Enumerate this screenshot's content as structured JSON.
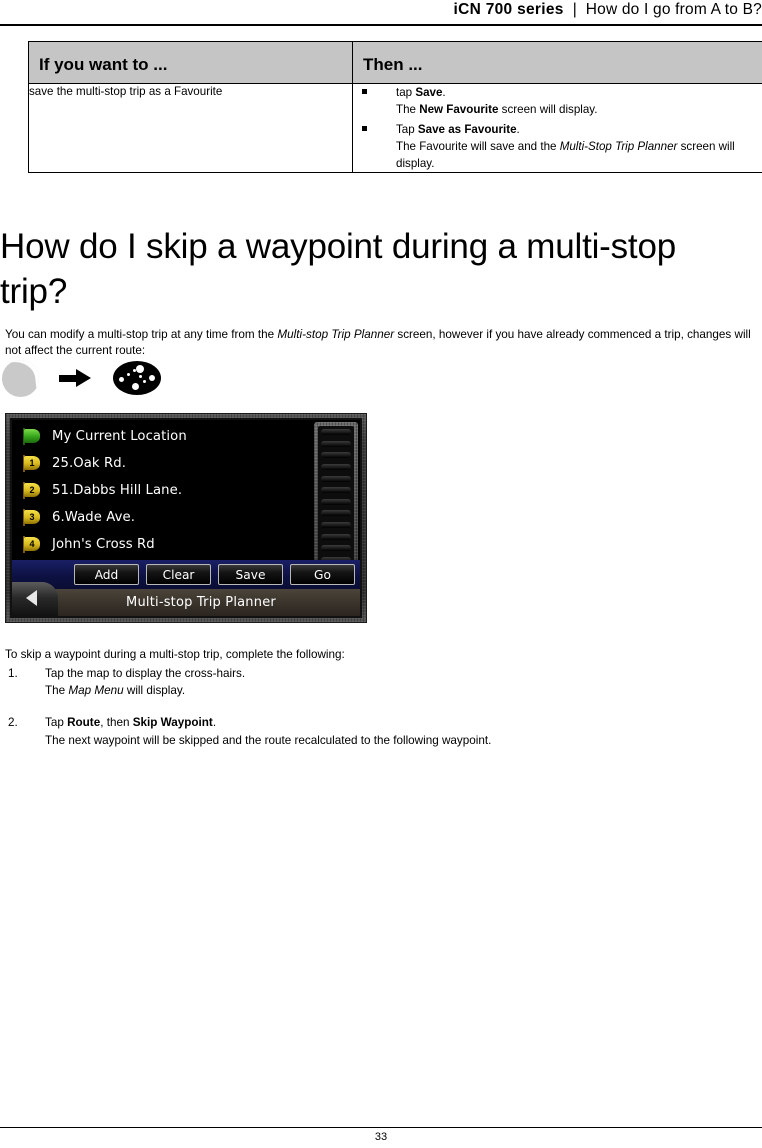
{
  "header": {
    "product": "iCN 700 series",
    "separator": "|",
    "chapter": "How do I go from A to B?"
  },
  "table": {
    "columns": [
      "If you want to ...",
      "Then ..."
    ],
    "rows": [
      {
        "left": "save the multi-stop trip as a Favourite",
        "bullets": [
          {
            "line1_pre": "tap ",
            "line1_bold": "Save",
            "line1_post": ".",
            "line2_pre": "The ",
            "line2_bold": "New Favourite",
            "line2_post": " screen will display."
          },
          {
            "line1_pre": "Tap ",
            "line1_bold": "Save as Favourite",
            "line1_post": ".",
            "line2_pre": "The Favourite will save and the ",
            "line2_italic": "Multi-Stop Trip Planner",
            "line2_post": " screen will display."
          }
        ]
      }
    ]
  },
  "heading": "How do I skip a waypoint during a multi-stop trip?",
  "intro": {
    "pre": "You can modify a multi-stop trip at any time from the ",
    "italic": "Multi-stop Trip Planner",
    "post": " screen, however if you have already commenced a trip, changes will not affect the current route:"
  },
  "icon_row": {
    "icons": [
      "road-map-icon",
      "arrow-right-icon",
      "multi-stop-trip-icon"
    ]
  },
  "device": {
    "waypoints": [
      {
        "flag": "green",
        "number": "",
        "label": "My Current Location"
      },
      {
        "flag": "yellow",
        "number": "1",
        "label": "25.Oak Rd."
      },
      {
        "flag": "yellow",
        "number": "2",
        "label": "51.Dabbs Hill Lane."
      },
      {
        "flag": "yellow",
        "number": "3",
        "label": "6.Wade Ave."
      },
      {
        "flag": "yellow",
        "number": "4",
        "label": "John's Cross Rd"
      }
    ],
    "buttons": [
      "Add",
      "Clear",
      "Save",
      "Go"
    ],
    "title": "Multi-stop Trip Planner",
    "back_icon": "chevron-left-icon",
    "scrollbar_color": "#f0a41e"
  },
  "lead_in": "To skip a waypoint during a multi-stop trip, complete the following:",
  "steps": [
    {
      "num": "1.",
      "line1": "Tap the map to display the cross-hairs.",
      "line2_pre": "The ",
      "line2_italic": "Map Menu",
      "line2_post": " will display."
    },
    {
      "num": "2.",
      "line1_pre": "Tap ",
      "line1_bold1": "Route",
      "line1_mid": ", then ",
      "line1_bold2": "Skip Waypoint",
      "line1_post": ".",
      "line2": "The next waypoint will be skipped and the route recalculated to the following waypoint."
    }
  ],
  "footer": {
    "page_number": "33"
  }
}
